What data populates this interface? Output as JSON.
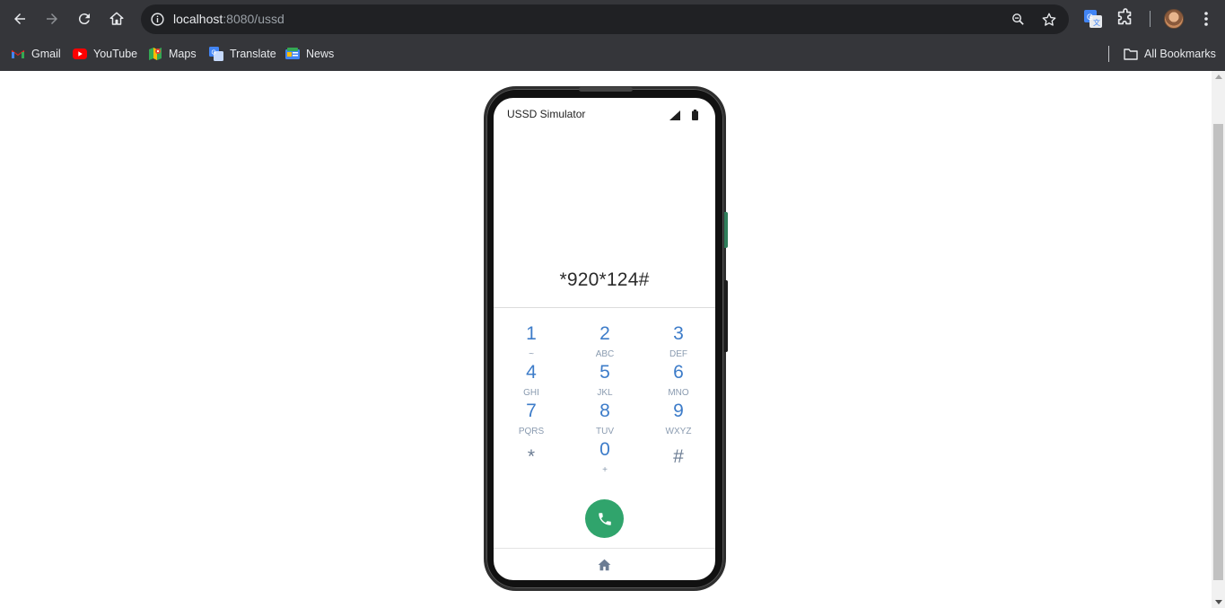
{
  "browser": {
    "url_host": "localhost",
    "url_rest": ":8080/ussd",
    "bookmarks": [
      {
        "label": "Gmail",
        "icon": "gmail-icon"
      },
      {
        "label": "YouTube",
        "icon": "youtube-icon"
      },
      {
        "label": "Maps",
        "icon": "maps-icon"
      },
      {
        "label": "Translate",
        "icon": "translate-icon"
      },
      {
        "label": "News",
        "icon": "news-icon"
      }
    ],
    "all_bookmarks_label": "All Bookmarks"
  },
  "phone": {
    "app_title": "USSD Simulator",
    "dialed_code": "*920*124#",
    "keys": [
      {
        "num": "1",
        "sub": "~"
      },
      {
        "num": "2",
        "sub": "ABC"
      },
      {
        "num": "3",
        "sub": "DEF"
      },
      {
        "num": "4",
        "sub": "GHI"
      },
      {
        "num": "5",
        "sub": "JKL"
      },
      {
        "num": "6",
        "sub": "MNO"
      },
      {
        "num": "7",
        "sub": "PQRS"
      },
      {
        "num": "8",
        "sub": "TUV"
      },
      {
        "num": "9",
        "sub": "WXYZ"
      },
      {
        "num": "*",
        "sub": ""
      },
      {
        "num": "0",
        "sub": "+"
      },
      {
        "num": "#",
        "sub": ""
      }
    ]
  },
  "colors": {
    "key_digit": "#3d7cc9",
    "key_letters": "#8a9bb0",
    "call_button": "#30a46c",
    "chrome_bg": "#35363a"
  }
}
